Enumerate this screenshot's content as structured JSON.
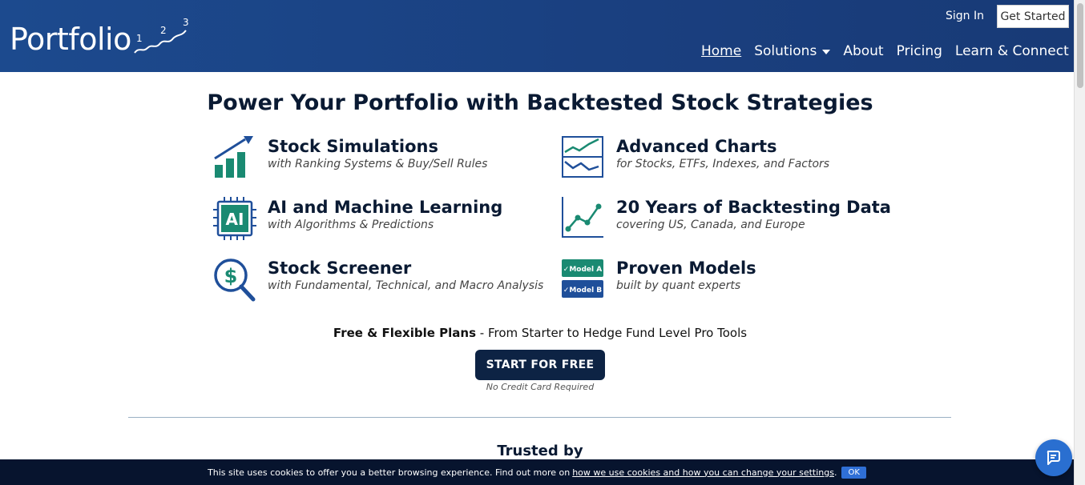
{
  "header": {
    "logo_text": "Portfolio",
    "logo_digits": [
      "1",
      "2",
      "3"
    ],
    "sign_in": "Sign In",
    "get_started": "Get Started",
    "nav": [
      {
        "label": "Home",
        "active": true,
        "dropdown": false
      },
      {
        "label": "Solutions",
        "active": false,
        "dropdown": true
      },
      {
        "label": "About",
        "active": false,
        "dropdown": false
      },
      {
        "label": "Pricing",
        "active": false,
        "dropdown": false
      },
      {
        "label": "Learn & Connect",
        "active": false,
        "dropdown": true
      }
    ]
  },
  "hero": {
    "title": "Power Your Portfolio with Backtested Stock Strategies"
  },
  "features": [
    {
      "title": "Stock Simulations",
      "subtitle": "with Ranking Systems & Buy/Sell Rules",
      "icon": "bar-chart-growth-icon"
    },
    {
      "title": "Advanced Charts",
      "subtitle": "for Stocks, ETFs, Indexes, and Factors",
      "icon": "line-charts-icon"
    },
    {
      "title": "AI and Machine Learning",
      "subtitle": "with Algorithms & Predictions",
      "icon": "ai-chip-icon"
    },
    {
      "title": "20 Years of Backtesting Data",
      "subtitle": "covering US, Canada, and Europe",
      "icon": "data-trend-icon"
    },
    {
      "title": "Stock Screener",
      "subtitle": "with Fundamental, Technical, and Macro Analysis",
      "icon": "dollar-magnifier-icon"
    },
    {
      "title": "Proven Models",
      "subtitle": "built by quant experts",
      "icon": "models-badge-icon"
    }
  ],
  "model_badges": [
    "✓Model A",
    "✓Model B"
  ],
  "cta": {
    "plans_bold": "Free & Flexible Plans",
    "plans_rest": " - From Starter to Hedge Fund Level Pro Tools",
    "button": "START FOR FREE",
    "note": "No Credit Card Required"
  },
  "trusted": "Trusted by",
  "cookie": {
    "text": "This site uses cookies to offer you a better browsing experience. Find out more on",
    "link": "how we use cookies and how you can change your settings",
    "period": ".",
    "ok": "OK"
  },
  "colors": {
    "header_blue": "#1c4a8e",
    "teal": "#1a8a72",
    "navy": "#0d2344",
    "icon_blue": "#1f4f9a"
  }
}
